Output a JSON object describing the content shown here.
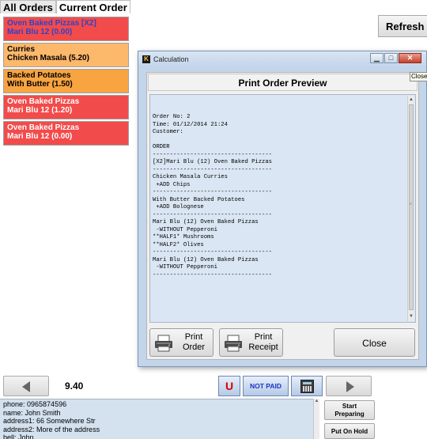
{
  "tabs": [
    {
      "label": "All Orders"
    },
    {
      "label": "Current Order"
    }
  ],
  "orders": [
    {
      "line1": "Oven Baked Pizzas [X2]",
      "line2": "Mari Blu 12 (0.00)",
      "color": "#f24b4b"
    },
    {
      "line1": "Curries",
      "line2": "Chicken Masala  (5.20)",
      "color": "#fcb86b"
    },
    {
      "line1": "Backed Potatoes",
      "line2": "With Butter  (1.50)",
      "color": "#f7a441"
    },
    {
      "line1": "Oven Baked Pizzas",
      "line2": "Mari Blu 12 (1.20)",
      "color": "#f24b4b"
    },
    {
      "line1": "Oven Baked Pizzas",
      "line2": "Mari Blu 12 (0.00)",
      "color": "#f24b4b"
    }
  ],
  "refresh_label": "Refresh",
  "dialog": {
    "app_icon_letter": "K",
    "window_title": "Calculation",
    "preview_title": "Print Order Preview",
    "minimize_glyph": "▁",
    "maximize_glyph": "□",
    "close_glyph": "✕",
    "receipt_text": "Order No: 2\nTime: 01/12/2014 21:24\nCustomer:\n\nORDER\n-----------------------------------\n[X2]Mari Blu (12) Oven Baked Pizzas\n-----------------------------------\nChicken Masala Curries\n +ADD Chips\n-----------------------------------\nWith Butter Backed Potatoes\n +ADD Bolognese\n-----------------------------------\nMari Blu (12) Oven Baked Pizzas\n -WITHOUT Pepperoni\n**HALF1* Mushrooms\n**HALF2* Olives\n-----------------------------------\nMari Blu (12) Oven Baked Pizzas\n -WITHOUT Pepperoni\n-----------------------------------\n\n\n\n\n\n\n\n\n.",
    "print_order_line1": "Print",
    "print_order_line2": "Order",
    "print_receipt_line1": "Print",
    "print_receipt_line2": "Receipt",
    "close_label": "Close",
    "tooltip": "Close"
  },
  "bottom": {
    "total": "9.40",
    "u_label": "U",
    "not_paid_label": "NOT PAID"
  },
  "customer_info": "phone: 0965874596\nname: John Smith\naddress1: 66 Somewhere Str\naddress2: More of the address\nbell: John",
  "side_buttons": {
    "start_line1": "Start",
    "start_line2": "Preparing",
    "hold": "Put On Hold"
  },
  "colors": {
    "dialog_bg": "#c3d5ea",
    "not_paid": "#1a37c7",
    "u_red": "#d40000"
  }
}
